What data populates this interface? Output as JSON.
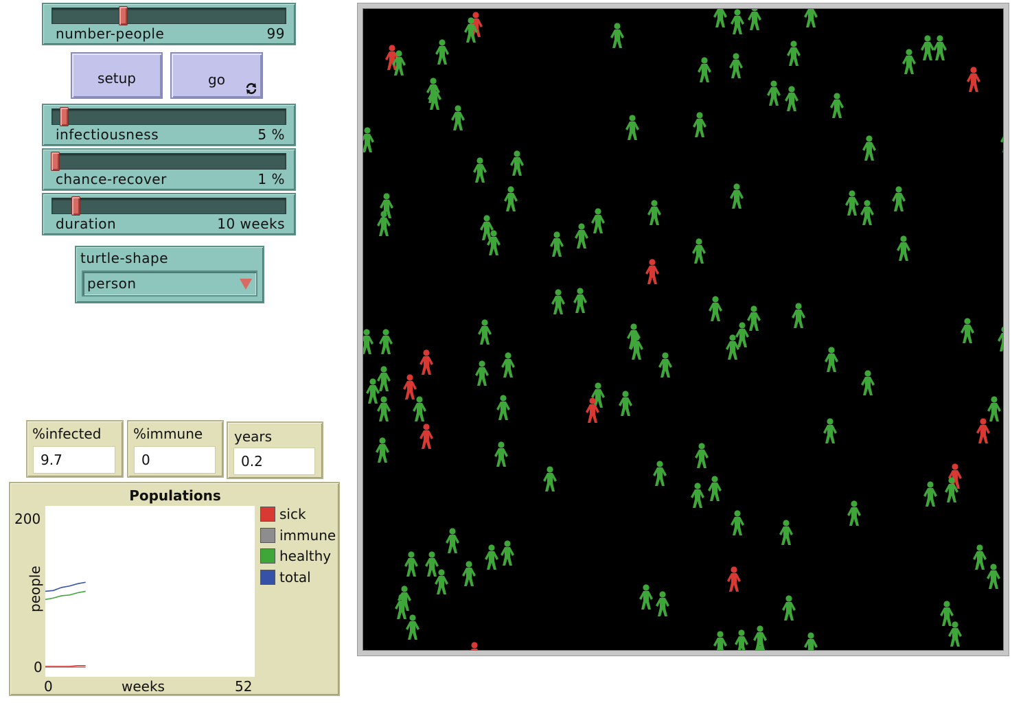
{
  "sliders": {
    "number_people": {
      "label": "number-people",
      "value": "99",
      "fraction": 0.33
    },
    "infectiousness": {
      "label": "infectiousness",
      "value": "5 %",
      "fraction": 0.05
    },
    "chance_recover": {
      "label": "chance-recover",
      "value": "1 %",
      "fraction": 0.0
    },
    "duration": {
      "label": "duration",
      "value": "10 weeks",
      "fraction": 0.1
    }
  },
  "buttons": {
    "setup": "setup",
    "go": "go",
    "go_forever_icon": "forever-icon"
  },
  "chooser": {
    "label": "turtle-shape",
    "value": "person"
  },
  "monitors": {
    "infected": {
      "label": "%infected",
      "value": "9.7"
    },
    "immune": {
      "label": "%immune",
      "value": "0"
    },
    "years": {
      "label": "years",
      "value": "0.2"
    }
  },
  "plot": {
    "title": "Populations",
    "xlabel": "weeks",
    "ylabel": "people",
    "xmin": "0",
    "xmax": "52",
    "ymin": "0",
    "ymax": "200",
    "legend": [
      {
        "name": "sick",
        "color": "#d83a33"
      },
      {
        "name": "immune",
        "color": "#8d8d8d"
      },
      {
        "name": "healthy",
        "color": "#3fa63a"
      },
      {
        "name": "total",
        "color": "#3552a8"
      }
    ]
  },
  "chart_data": {
    "type": "line",
    "title": "Populations",
    "xlabel": "weeks",
    "ylabel": "people",
    "xlim": [
      0,
      52
    ],
    "ylim": [
      0,
      200
    ],
    "legend_position": "right",
    "series": [
      {
        "name": "sick",
        "color": "#d83a33",
        "x": [
          0,
          2,
          4,
          6,
          8,
          10
        ],
        "values": [
          1,
          1,
          1,
          1,
          2,
          2
        ]
      },
      {
        "name": "immune",
        "color": "#8d8d8d",
        "x": [
          0,
          2,
          4,
          6,
          8,
          10
        ],
        "values": [
          0,
          0,
          0,
          0,
          0,
          0
        ]
      },
      {
        "name": "healthy",
        "color": "#3fa63a",
        "x": [
          0,
          2,
          4,
          6,
          8,
          10
        ],
        "values": [
          90,
          92,
          95,
          96,
          99,
          101
        ]
      },
      {
        "name": "total",
        "color": "#3552a8",
        "x": [
          0,
          2,
          4,
          6,
          8,
          10
        ],
        "values": [
          101,
          102,
          106,
          108,
          111,
          113
        ]
      }
    ]
  },
  "world": {
    "background": "#000000",
    "healthy_color": "#3fa63a",
    "sick_color": "#d83a33",
    "turtle_shape": "person-icon"
  }
}
